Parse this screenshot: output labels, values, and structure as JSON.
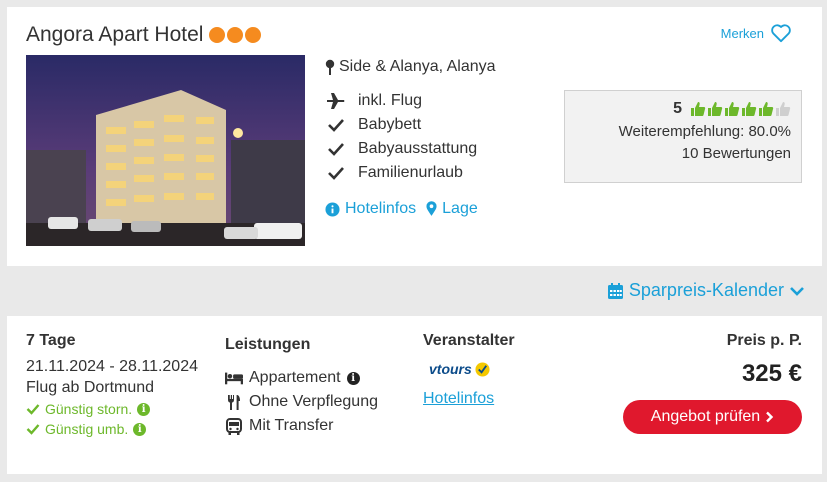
{
  "hotel": {
    "name": "Angora Apart Hotel",
    "stars": 3,
    "merken_label": "Merken",
    "location": "Side & Alanya, Alanya",
    "features": [
      {
        "icon": "plane-icon",
        "label": "inkl. Flug"
      },
      {
        "icon": "check-icon",
        "label": "Babybett"
      },
      {
        "icon": "check-icon",
        "label": "Babyausstattung"
      },
      {
        "icon": "check-icon",
        "label": "Familienurlaub"
      }
    ],
    "links": {
      "hotelinfos": "Hotelinfos",
      "lage": "Lage"
    },
    "rating": {
      "score": "5",
      "thumbs_filled": 5,
      "thumbs_total": 6,
      "recommendation": "Weiterempfehlung: 80.0%",
      "reviews": "10 Bewertungen"
    }
  },
  "calendar_link": "Sparpreis-Kalender",
  "offer": {
    "duration": "7 Tage",
    "dates": "21.11.2024 - 28.11.2024",
    "departure": "Flug ab Dortmund",
    "flex1": "Günstig storn.",
    "flex2": "Günstig umb.",
    "services_heading": "Leistungen",
    "services": [
      {
        "icon": "bed-icon",
        "label": "Appartement"
      },
      {
        "icon": "cutlery-icon",
        "label": "Ohne Verpflegung"
      },
      {
        "icon": "bus-icon",
        "label": "Mit Transfer"
      }
    ],
    "operator_heading": "Veranstalter",
    "operator_logo_text": "vtours",
    "operator_link": "Hotelinfos",
    "price_heading": "Preis p. P.",
    "price": "325 €",
    "cta": "Angebot prüfen"
  },
  "colors": {
    "accent": "#1ba0d8",
    "star": "#f58b1f",
    "thumb": "#6db82b",
    "cta": "#e0182d"
  }
}
